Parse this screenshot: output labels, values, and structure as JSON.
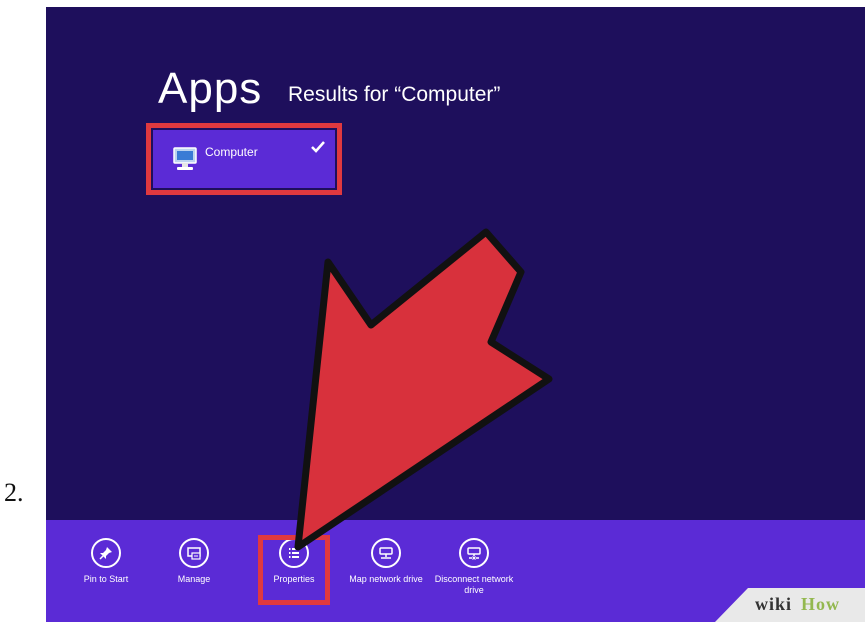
{
  "step": {
    "number": "2."
  },
  "heading": {
    "title": "Apps",
    "results": "Results for “Computer”"
  },
  "app_result": {
    "label": "Computer",
    "selected": true,
    "icon": "computer-icon"
  },
  "app_bar": {
    "buttons": [
      {
        "label": "Pin to Start",
        "icon": "pin-icon"
      },
      {
        "label": "Manage",
        "icon": "manage-icon"
      },
      {
        "label": "Properties",
        "icon": "properties-icon"
      },
      {
        "label": "Map network drive",
        "icon": "map-drive-icon"
      },
      {
        "label": "Disconnect network drive",
        "icon": "disconnect-drive-icon"
      }
    ]
  },
  "watermark": {
    "wiki": "wiki",
    "how": "How"
  },
  "colors": {
    "background": "#1e0f5c",
    "tile": "#5b2bd6",
    "highlight": "#e0393f",
    "arrow": "#d8313c"
  }
}
